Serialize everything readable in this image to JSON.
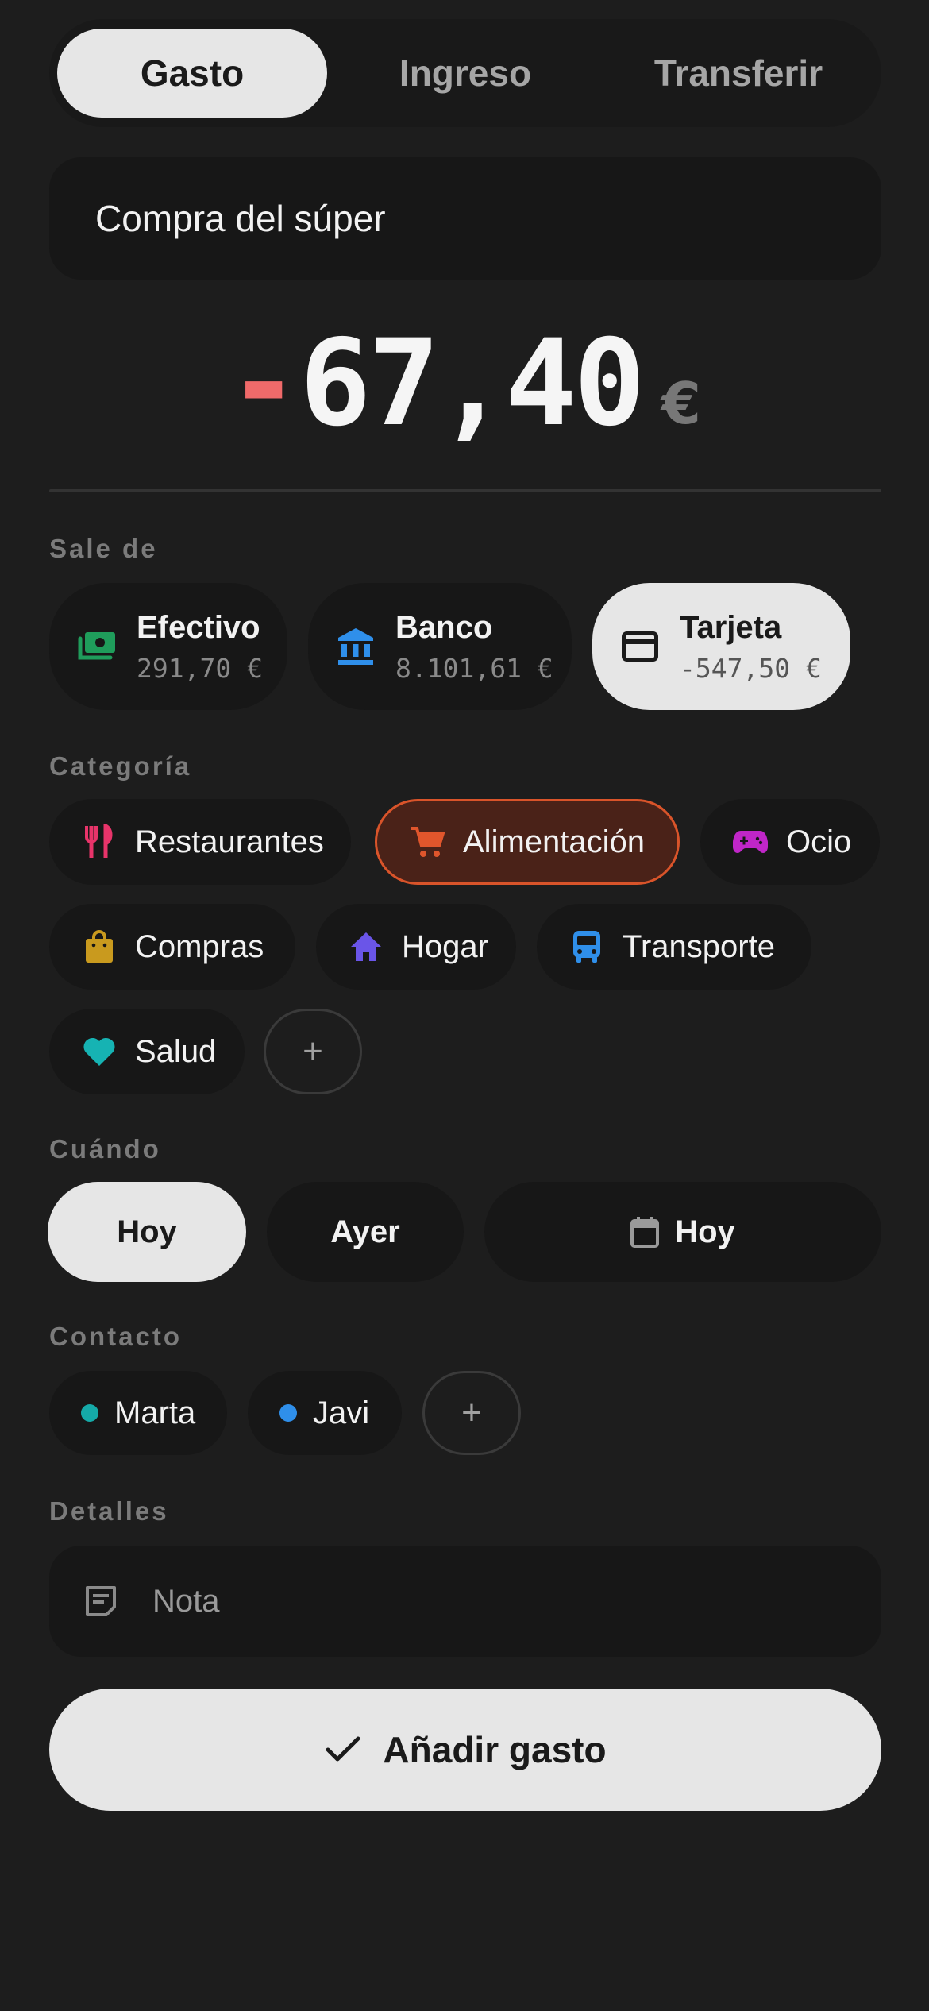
{
  "tabs": [
    "Gasto",
    "Ingreso",
    "Transferir"
  ],
  "title_value": "Compra del súper",
  "amount": {
    "sign": "-",
    "value": "67,40",
    "currency": "€"
  },
  "sections": {
    "from": "Sale de",
    "category": "Categoría",
    "when": "Cuándo",
    "contact": "Contacto",
    "details": "Detalles"
  },
  "accounts": [
    {
      "name": "Efectivo",
      "balance": "291,70 €",
      "icon": "cash-icon",
      "color": "#1f9d5b"
    },
    {
      "name": "Banco",
      "balance": "8.101,61 €",
      "icon": "bank-icon",
      "color": "#2f8fea"
    },
    {
      "name": "Tarjeta",
      "balance": "-547,50 €",
      "icon": "credit-card-icon",
      "color": "#1a1a1a",
      "selected": true
    }
  ],
  "categories": [
    {
      "label": "Restaurantes",
      "icon": "fork-knife-icon",
      "color": "#e8346a"
    },
    {
      "label": "Alimentación",
      "icon": "cart-icon",
      "color": "#e0562c",
      "selected": true
    },
    {
      "label": "Ocio",
      "icon": "gamepad-icon",
      "color": "#c026c8"
    },
    {
      "label": "Compras",
      "icon": "shopping-bag-icon",
      "color": "#c99a1e"
    },
    {
      "label": "Hogar",
      "icon": "home-icon",
      "color": "#6a55e8"
    },
    {
      "label": "Transporte",
      "icon": "bus-icon",
      "color": "#2f8fea"
    },
    {
      "label": "Salud",
      "icon": "heart-icon",
      "color": "#16b3b3"
    }
  ],
  "add_symbol": "+",
  "when": {
    "today": "Hoy",
    "yesterday": "Ayer",
    "date_value": "Hoy",
    "selected": "Hoy"
  },
  "contacts": [
    {
      "name": "Marta",
      "color": "#15aaa8"
    },
    {
      "name": "Javi",
      "color": "#2f8fea"
    }
  ],
  "note_placeholder": "Nota",
  "submit_label": "Añadir gasto"
}
